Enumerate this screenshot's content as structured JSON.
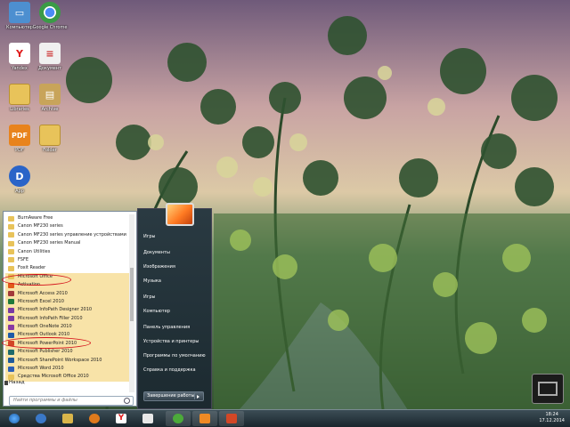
{
  "desktop_icons": [
    {
      "name": "computer",
      "label": "Компьютер",
      "icon": "computer-icon",
      "color": "#4d8fd0"
    },
    {
      "name": "chrome",
      "label": "Google Chrome",
      "icon": "chrome-icon",
      "color": "#3a9b46"
    },
    {
      "name": "yandex",
      "label": "Yandex",
      "icon": "yandex-icon",
      "color": "#ffffff"
    },
    {
      "name": "doc",
      "label": "Документ",
      "icon": "document-icon",
      "color": "#f0f0f0"
    },
    {
      "name": "folder",
      "label": "Libraries",
      "icon": "folder-icon",
      "color": "#d9b54a"
    },
    {
      "name": "archive",
      "label": "Archive",
      "icon": "archive-icon",
      "color": "#c8a45a"
    },
    {
      "name": "pdf",
      "label": "PDF",
      "icon": "pdf-icon",
      "color": "#e8831c"
    },
    {
      "name": "folder2",
      "label": "Folder",
      "icon": "folder-icon",
      "color": "#d9b54a"
    },
    {
      "name": "dapp",
      "label": "App",
      "icon": "app-icon",
      "color": "#2a64c8"
    }
  ],
  "start_menu": {
    "programs": [
      {
        "label": "BurnAware Free",
        "icon": "folder-icon",
        "highlight": false
      },
      {
        "label": "Canon MF230 series",
        "icon": "folder-icon",
        "highlight": false
      },
      {
        "label": "Canon MF230 series управление устройствами",
        "icon": "folder-icon",
        "highlight": false
      },
      {
        "label": "Canon MF230 series Manual",
        "icon": "folder-icon",
        "highlight": false
      },
      {
        "label": "Canon Utilities",
        "icon": "folder-icon",
        "highlight": false
      },
      {
        "label": "FSFE",
        "icon": "folder-icon",
        "highlight": false
      },
      {
        "label": "Foxit Reader",
        "icon": "folder-icon",
        "highlight": false
      },
      {
        "label": "Microsoft Office",
        "icon": "folder-icon",
        "highlight": true
      },
      {
        "label": "Activation",
        "icon": "office-icon",
        "highlight": true
      },
      {
        "label": "Microsoft Access 2010",
        "icon": "access-icon",
        "highlight": true
      },
      {
        "label": "Microsoft Excel 2010",
        "icon": "excel-icon",
        "highlight": true
      },
      {
        "label": "Microsoft InfoPath Designer 2010",
        "icon": "infopath-icon",
        "highlight": true
      },
      {
        "label": "Microsoft InfoPath Filler 2010",
        "icon": "infopath-icon",
        "highlight": true
      },
      {
        "label": "Microsoft OneNote 2010",
        "icon": "onenote-icon",
        "highlight": true
      },
      {
        "label": "Microsoft Outlook 2010",
        "icon": "outlook-icon",
        "highlight": true
      },
      {
        "label": "Microsoft PowerPoint 2010",
        "icon": "powerpoint-icon",
        "highlight": true
      },
      {
        "label": "Microsoft Publisher 2010",
        "icon": "publisher-icon",
        "highlight": true
      },
      {
        "label": "Microsoft SharePoint Workspace 2010",
        "icon": "sharepoint-icon",
        "highlight": true
      },
      {
        "label": "Microsoft Word 2010",
        "icon": "word-icon",
        "highlight": true
      },
      {
        "label": "Средства Microsoft Office 2010",
        "icon": "folder-icon",
        "highlight": true
      }
    ],
    "back_label": "Назад",
    "search_placeholder": "Найти программы и файлы",
    "right_links": [
      "Игры",
      "Документы",
      "Изображения",
      "Музыка",
      "Игры",
      "Компьютер",
      "Панель управления",
      "Устройства и принтеры",
      "Программы по умолчанию",
      "Справка и поддержка"
    ],
    "shutdown_label": "Завершение работы"
  },
  "taskbar": {
    "items": [
      {
        "name": "start",
        "icon": "windows-logo-icon",
        "color": "#2c87d6"
      },
      {
        "name": "ie",
        "icon": "ie-icon",
        "color": "#3a78c8"
      },
      {
        "name": "explorer",
        "icon": "explorer-icon",
        "color": "#d9b54a"
      },
      {
        "name": "media",
        "icon": "media-player-icon",
        "color": "#e07a1c"
      },
      {
        "name": "yandex",
        "icon": "yandex-icon",
        "color": "#ffffff"
      },
      {
        "name": "docs",
        "icon": "document-icon",
        "color": "#e8e8e8"
      },
      {
        "name": "torrent",
        "icon": "torrent-icon",
        "color": "#4caa3a"
      },
      {
        "name": "orange",
        "icon": "app-icon",
        "color": "#f08a24"
      },
      {
        "name": "powerpoint",
        "icon": "powerpoint-icon",
        "color": "#d24726"
      }
    ],
    "time": "18:24",
    "date": "17.12.2014"
  }
}
